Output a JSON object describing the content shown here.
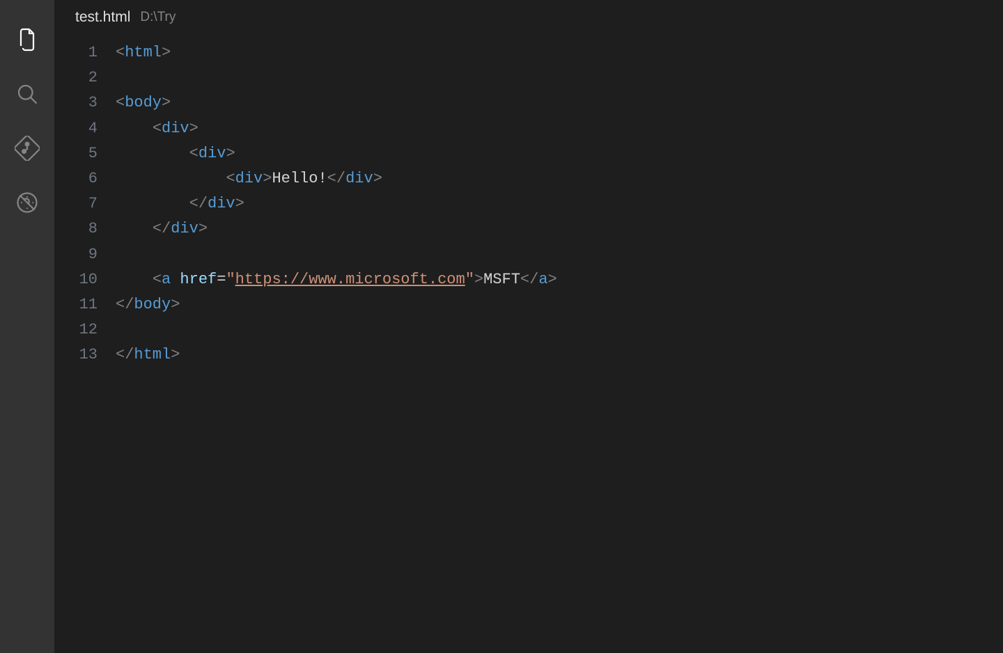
{
  "activityBar": {
    "items": [
      {
        "name": "explorer",
        "active": true
      },
      {
        "name": "search",
        "active": false
      },
      {
        "name": "source-control",
        "active": false
      },
      {
        "name": "debug",
        "active": false
      }
    ]
  },
  "tab": {
    "filename": "test.html",
    "path": "D:\\Try"
  },
  "editor": {
    "lineNumbers": [
      "1",
      "2",
      "3",
      "4",
      "5",
      "6",
      "7",
      "8",
      "9",
      "10",
      "11",
      "12",
      "13"
    ],
    "lines": [
      [
        {
          "cls": "bracket",
          "t": "<"
        },
        {
          "cls": "tag",
          "t": "html"
        },
        {
          "cls": "bracket",
          "t": ">"
        }
      ],
      [],
      [
        {
          "cls": "bracket",
          "t": "<"
        },
        {
          "cls": "tag",
          "t": "body"
        },
        {
          "cls": "bracket",
          "t": ">"
        }
      ],
      [
        {
          "cls": "text",
          "t": "    "
        },
        {
          "cls": "bracket",
          "t": "<"
        },
        {
          "cls": "tag",
          "t": "div"
        },
        {
          "cls": "bracket",
          "t": ">"
        }
      ],
      [
        {
          "cls": "text",
          "t": "        "
        },
        {
          "cls": "bracket",
          "t": "<"
        },
        {
          "cls": "tag",
          "t": "div"
        },
        {
          "cls": "bracket",
          "t": ">"
        }
      ],
      [
        {
          "cls": "text",
          "t": "            "
        },
        {
          "cls": "bracket",
          "t": "<"
        },
        {
          "cls": "tag",
          "t": "div"
        },
        {
          "cls": "bracket",
          "t": ">"
        },
        {
          "cls": "text",
          "t": "Hello!"
        },
        {
          "cls": "bracket",
          "t": "</"
        },
        {
          "cls": "tag",
          "t": "div"
        },
        {
          "cls": "bracket",
          "t": ">"
        }
      ],
      [
        {
          "cls": "text",
          "t": "        "
        },
        {
          "cls": "bracket",
          "t": "</"
        },
        {
          "cls": "tag",
          "t": "div"
        },
        {
          "cls": "bracket",
          "t": ">"
        }
      ],
      [
        {
          "cls": "text",
          "t": "    "
        },
        {
          "cls": "bracket",
          "t": "</"
        },
        {
          "cls": "tag",
          "t": "div"
        },
        {
          "cls": "bracket",
          "t": ">"
        }
      ],
      [],
      [
        {
          "cls": "text",
          "t": "    "
        },
        {
          "cls": "bracket",
          "t": "<"
        },
        {
          "cls": "tag",
          "t": "a"
        },
        {
          "cls": "text",
          "t": " "
        },
        {
          "cls": "attr",
          "t": "href"
        },
        {
          "cls": "eq",
          "t": "="
        },
        {
          "cls": "str",
          "t": "\""
        },
        {
          "cls": "link",
          "t": "https://www.microsoft.com"
        },
        {
          "cls": "str",
          "t": "\""
        },
        {
          "cls": "bracket",
          "t": ">"
        },
        {
          "cls": "text",
          "t": "MSFT"
        },
        {
          "cls": "bracket",
          "t": "</"
        },
        {
          "cls": "tag",
          "t": "a"
        },
        {
          "cls": "bracket",
          "t": ">"
        }
      ],
      [
        {
          "cls": "bracket",
          "t": "</"
        },
        {
          "cls": "tag",
          "t": "body"
        },
        {
          "cls": "bracket",
          "t": ">"
        }
      ],
      [],
      [
        {
          "cls": "bracket",
          "t": "</"
        },
        {
          "cls": "tag",
          "t": "html"
        },
        {
          "cls": "bracket",
          "t": ">"
        }
      ]
    ]
  }
}
